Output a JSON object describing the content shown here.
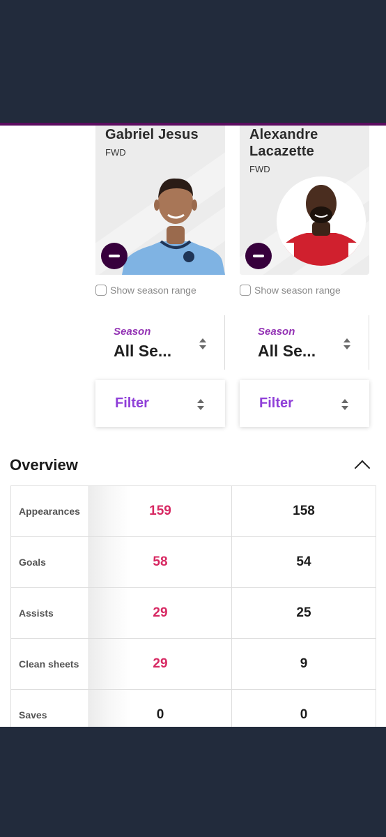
{
  "players": [
    {
      "name_line1": "Gabriel Jesus",
      "name_line2": "",
      "position": "FWD",
      "photo": "player-photo-light-blue-kit",
      "season_range_label": "Show season range",
      "season_label": "Season",
      "season_value": "All Se...",
      "filter_label": "Filter"
    },
    {
      "name_line1": "Alexandre",
      "name_line2": "Lacazette",
      "position": "FWD",
      "photo": "player-photo-red-kit",
      "season_range_label": "Show season range",
      "season_label": "Season",
      "season_value": "All Se...",
      "filter_label": "Filter"
    }
  ],
  "overview": {
    "title": "Overview",
    "rows": [
      {
        "label": "Appearances",
        "a": "159",
        "b": "158",
        "a_highlight": true
      },
      {
        "label": "Goals",
        "a": "58",
        "b": "54",
        "a_highlight": true
      },
      {
        "label": "Assists",
        "a": "29",
        "b": "25",
        "a_highlight": true
      },
      {
        "label": "Clean sheets",
        "a": "29",
        "b": "9",
        "a_highlight": true
      },
      {
        "label": "Saves",
        "a": "0",
        "b": "0",
        "a_highlight": false
      }
    ]
  },
  "colors": {
    "header_bg": "#222b3c",
    "accent_purple": "#37003c",
    "highlight_pink": "#d72862",
    "season_purple": "#9333b4"
  }
}
